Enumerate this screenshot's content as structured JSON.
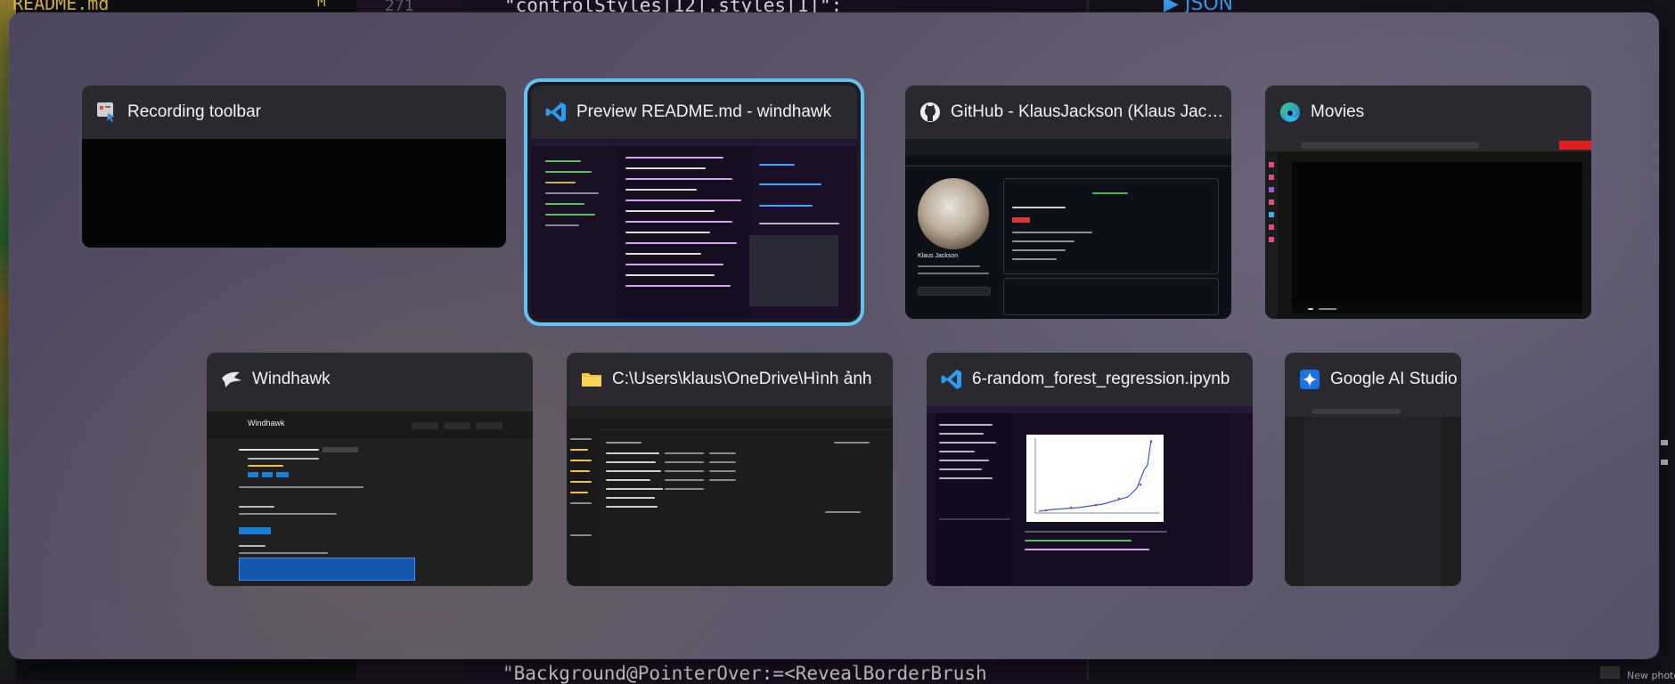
{
  "background": {
    "left_filename": "README.md",
    "left_status": "M",
    "line_number": "271",
    "code_line_top": "\"controlStyles[12].styles[1]\":",
    "code_line_bottom": "\"Background@PointerOver:=<RevealBorderBrush",
    "right_heading": "▶ JSON",
    "tray_label": "New photo"
  },
  "switcher": {
    "windows": [
      {
        "title": "Recording toolbar",
        "icon": "recording-toolbar-icon",
        "selected": false
      },
      {
        "title": "Preview README.md - windhawk",
        "icon": "vscode-icon",
        "selected": true
      },
      {
        "title": "GitHub - KlausJackson (Klaus Jackson)",
        "icon": "github-icon",
        "selected": false
      },
      {
        "title": "Movies",
        "icon": "edge-icon",
        "selected": false
      },
      {
        "title": "Windhawk",
        "icon": "windhawk-icon",
        "selected": false
      },
      {
        "title": "C:\\Users\\klaus\\OneDrive\\Hình ảnh",
        "icon": "folder-icon",
        "selected": false
      },
      {
        "title": "6-random_forest_regression.ipynb",
        "icon": "vscode-icon",
        "selected": false
      },
      {
        "title": "Google AI Studio",
        "icon": "google-ai-studio-icon",
        "selected": false
      }
    ],
    "previews": {
      "github_profile_name": "Klaus Jackson",
      "windhawk_app_name": "Windhawk"
    }
  },
  "colors": {
    "selection_ring": "#61c3f2",
    "vscode_blue": "#2d9bf0",
    "edge_gradient": "#2fb9e8",
    "folder_yellow": "#f4c53b"
  }
}
